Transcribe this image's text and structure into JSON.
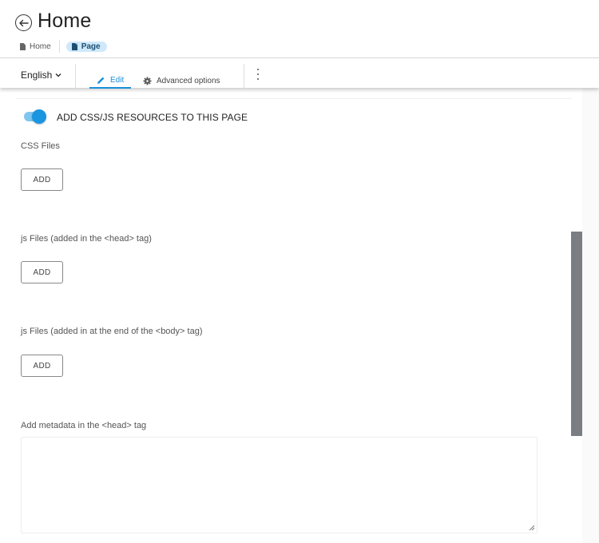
{
  "header": {
    "title": "Home",
    "breadcrumb": [
      {
        "label": "Home",
        "icon": "document-icon"
      },
      {
        "label": "Page",
        "icon": "document-icon",
        "active": true
      }
    ]
  },
  "toolbar": {
    "language": "English",
    "tabs": [
      {
        "label": "Edit",
        "icon": "pencil-icon",
        "active": true
      },
      {
        "label": "Advanced options",
        "icon": "gear-icon"
      }
    ],
    "more_icon": "kebab-menu-icon"
  },
  "form": {
    "toggle": {
      "label": "ADD CSS/JS RESOURCES TO THIS PAGE",
      "checked": true
    },
    "css_files": {
      "label": "CSS Files",
      "button": "ADD"
    },
    "js_head": {
      "label": "js Files (added in the <head> tag)",
      "button": "ADD"
    },
    "js_body": {
      "label": "js Files (added in at the end of the <body> tag)",
      "button": "ADD"
    },
    "metadata": {
      "label": "Add metadata in the <head> tag",
      "value": ""
    }
  },
  "colors": {
    "accent": "#1a95e0",
    "crumb_active_bg": "#cfe9fb",
    "scroll_thumb": "#7a7d82"
  }
}
